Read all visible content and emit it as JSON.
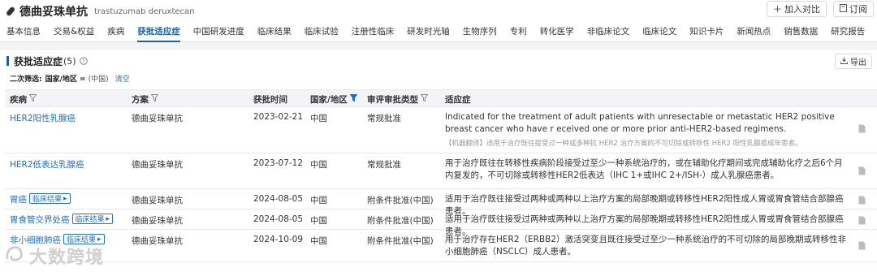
{
  "header": {
    "drug_name": "德曲妥珠单抗",
    "drug_name_en": "trastuzumab deruxtecan",
    "compare_label": "加入对比",
    "subscribe_label": "订阅"
  },
  "nav": {
    "tabs": [
      "基本信息",
      "交易&权益",
      "疾病",
      "获批适应症",
      "中国研发进度",
      "临床结果",
      "临床试验",
      "注册性临床",
      "研发时光轴",
      "生物序列",
      "专利",
      "转化医学",
      "非临床论文",
      "临床论文",
      "知识卡片",
      "新闻热点",
      "销售数据",
      "研究报告"
    ],
    "active_index": 3
  },
  "section": {
    "title": "获批适应症",
    "count": "(5)",
    "export_label": "导出",
    "filter_label": "二次筛选:",
    "filter_key": "国家/地区 =",
    "filter_value": "(中国)",
    "filter_clear": "清空"
  },
  "table": {
    "headers": [
      "疾病",
      "方案",
      "获批时间",
      "国家/地区",
      "审评审批类型",
      "适应症"
    ],
    "rows": [
      {
        "disease": "HER2阳性乳腺癌",
        "tag": "",
        "regimen": "德曲妥珠单抗",
        "date": "2023-02-21",
        "country": "中国",
        "type": "常规批准",
        "indication": "Indicated for the treatment of adult patients with unresectable or metastatic HER2 positive breast cancer who have r eceived one or more prior anti-HER2-based regimens.",
        "machine_translation": "【机器翻译】适用于治疗既往接受过一种或多种抗 HER2 治疗方案的不可切除或转移性 HER2 阳性乳腺癌成年患者。"
      },
      {
        "disease": "HER2低表达乳腺癌",
        "tag": "",
        "regimen": "德曲妥珠单抗",
        "date": "2023-07-12",
        "country": "中国",
        "type": "常规批准",
        "indication": "用于治疗既往在转移性疾病阶段接受过至少一种系统治疗的，或在辅助化疗期间或完成辅助化疗之后6个月内复发的，不可切除或转移性HER2低表达（IHC 1+或IHC 2+/ISH-）成人乳腺癌患者。",
        "machine_translation": ""
      },
      {
        "disease": "胃癌",
        "tag": "临床结果",
        "regimen": "德曲妥珠单抗",
        "date": "2024-08-05",
        "country": "中国",
        "type": "附条件批准(中国)",
        "indication": "适用于治疗既往接受过两种或两种以上治疗方案的局部晚期或转移性HER2阳性成人胃或胃食管结合部腺癌患者。",
        "machine_translation": ""
      },
      {
        "disease": "胃食管交界处癌",
        "tag": "临床结果",
        "regimen": "德曲妥珠单抗",
        "date": "2024-08-05",
        "country": "中国",
        "type": "附条件批准(中国)",
        "indication": "适用于治疗既往接受过两种或两种以上治疗方案的局部晚期或转移性HER2阳性成人胃或胃食管结合部腺癌患者。",
        "machine_translation": ""
      },
      {
        "disease": "非小细胞肺癌",
        "tag": "临床结果",
        "regimen": "德曲妥珠单抗",
        "date": "2024-10-09",
        "country": "中国",
        "type": "附条件批准(中国)",
        "indication": "用于治疗存在HER2（ERBB2）激活突变且既往接受过至少一种系统治疗的不可切除的局部晚期或转移性非小细胞肺癌（NSCLC）成人患者。",
        "machine_translation": ""
      }
    ]
  },
  "watermark": "大数跨境",
  "colors": {
    "accent": "#1f5fa8",
    "link": "#1f6fc8"
  }
}
